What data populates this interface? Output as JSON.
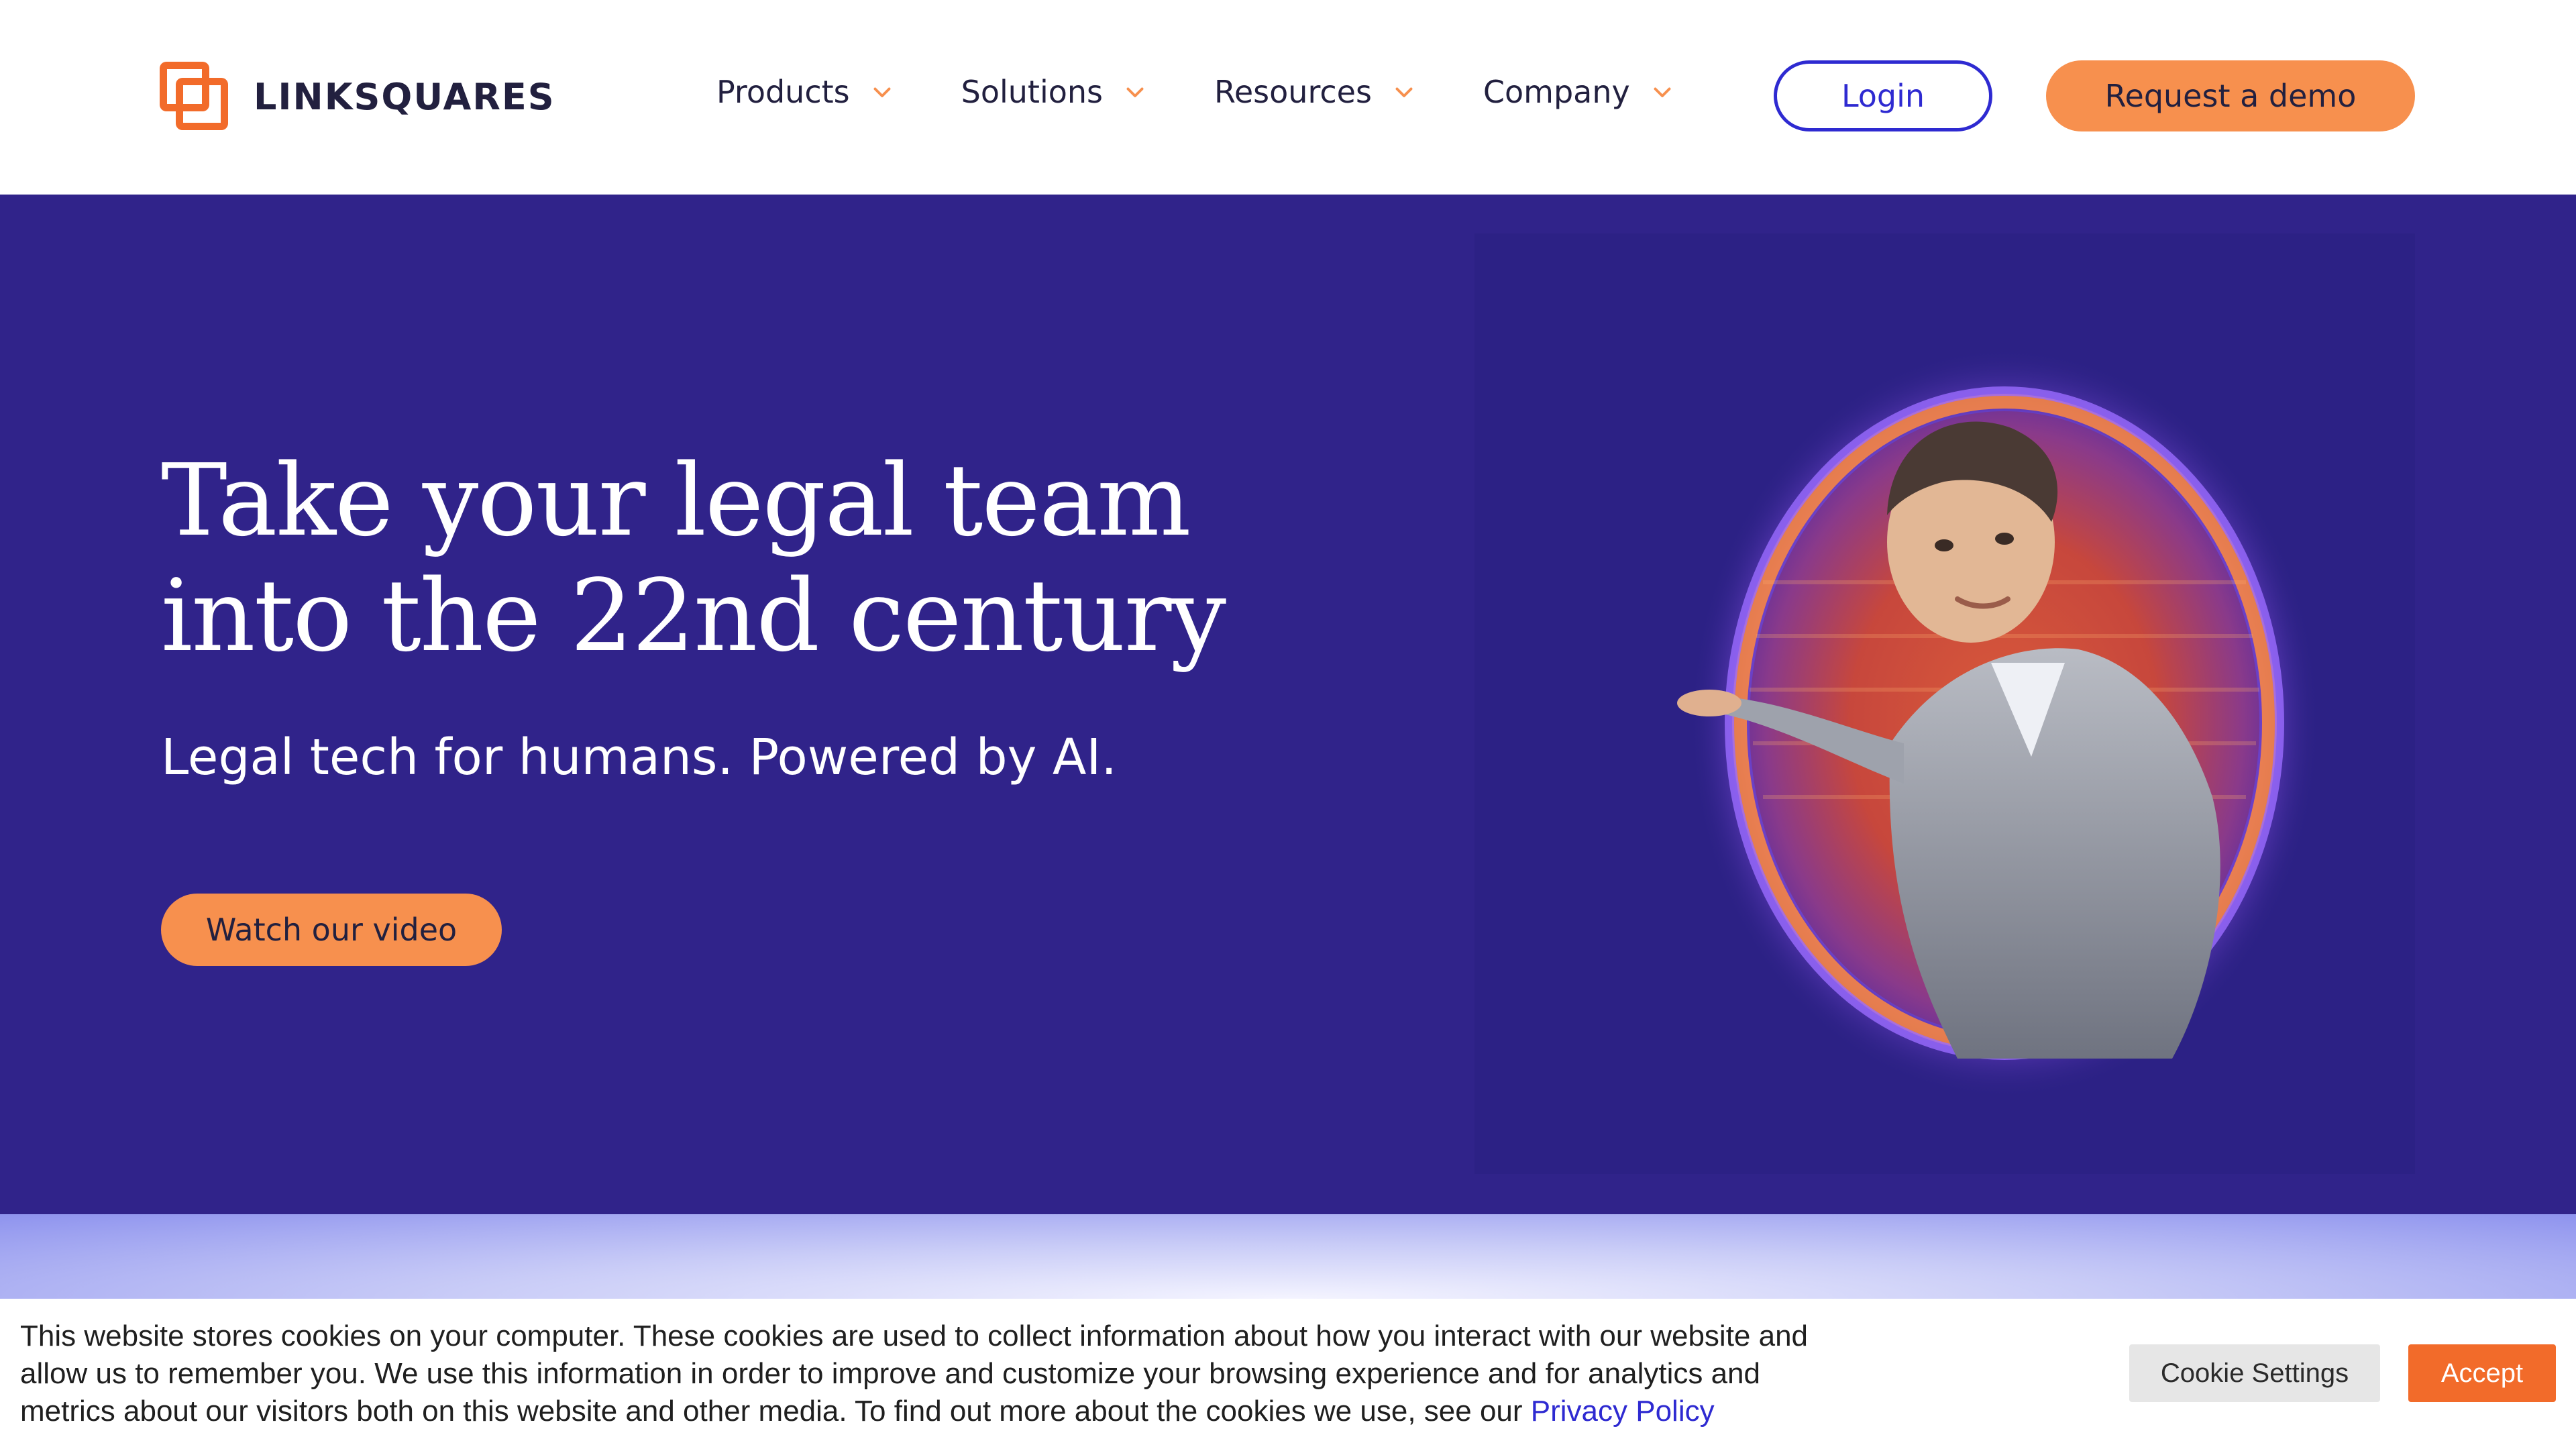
{
  "brand": {
    "name": "LINKSQUARES",
    "logo_icon": "linksquares-logo-icon",
    "accent_orange": "#f7904e",
    "brand_orange": "#f26b2a",
    "primary_blue": "#2e2ad1",
    "hero_background": "#30238a"
  },
  "nav": {
    "items": [
      {
        "label": "Products",
        "icon": "chevron-down-icon"
      },
      {
        "label": "Solutions",
        "icon": "chevron-down-icon"
      },
      {
        "label": "Resources",
        "icon": "chevron-down-icon"
      },
      {
        "label": "Company",
        "icon": "chevron-down-icon"
      }
    ],
    "login_label": "Login",
    "demo_label": "Request a demo"
  },
  "hero": {
    "title_line1": "Take your legal team",
    "title_line2": "into the 22nd century",
    "subtitle": "Legal tech for humans. Powered by AI.",
    "cta_label": "Watch our video",
    "media": "man-in-glowing-portal-image"
  },
  "cookie": {
    "text": "This website stores cookies on your computer. These cookies are used to collect information about how you interact with our website and allow us to remember you. We use this information in order to improve and customize your browsing experience and for analytics and metrics about our visitors both on this website and other media. To find out more about the cookies we use, see our",
    "link_label": "Privacy Policy",
    "settings_label": "Cookie Settings",
    "accept_label": "Accept"
  }
}
